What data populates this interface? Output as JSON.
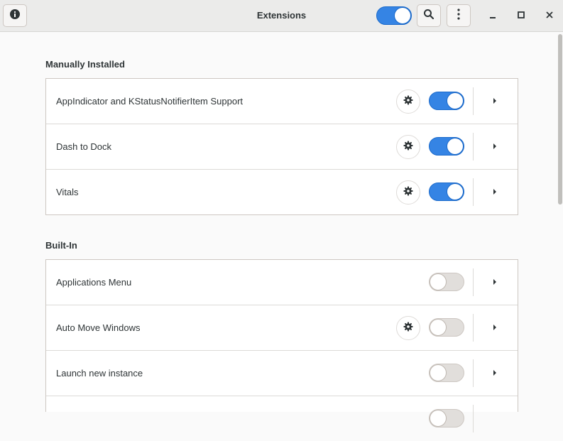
{
  "window": {
    "title": "Extensions",
    "extensions_enabled": true
  },
  "header": {
    "about_icon": "info-icon",
    "search_icon": "search-icon",
    "menu_icon": "kebab-menu-icon",
    "minimize_icon": "minimize-icon",
    "maximize_icon": "maximize-icon",
    "close_icon": "close-icon"
  },
  "sections": [
    {
      "title": "Manually Installed",
      "items": [
        {
          "name": "AppIndicator and KStatusNotifierItem Support",
          "has_settings": true,
          "enabled": true
        },
        {
          "name": "Dash to Dock",
          "has_settings": true,
          "enabled": true
        },
        {
          "name": "Vitals",
          "has_settings": true,
          "enabled": true
        }
      ]
    },
    {
      "title": "Built-In",
      "items": [
        {
          "name": "Applications Menu",
          "has_settings": false,
          "enabled": false
        },
        {
          "name": "Auto Move Windows",
          "has_settings": true,
          "enabled": false
        },
        {
          "name": "Launch new instance",
          "has_settings": false,
          "enabled": false
        },
        {
          "name": "",
          "has_settings": false,
          "enabled": false
        }
      ]
    }
  ],
  "colors": {
    "accent": "#3584e4",
    "toggle_off": "#e1dedb",
    "header_bg": "#ebebea",
    "window_bg": "#fafafa"
  }
}
